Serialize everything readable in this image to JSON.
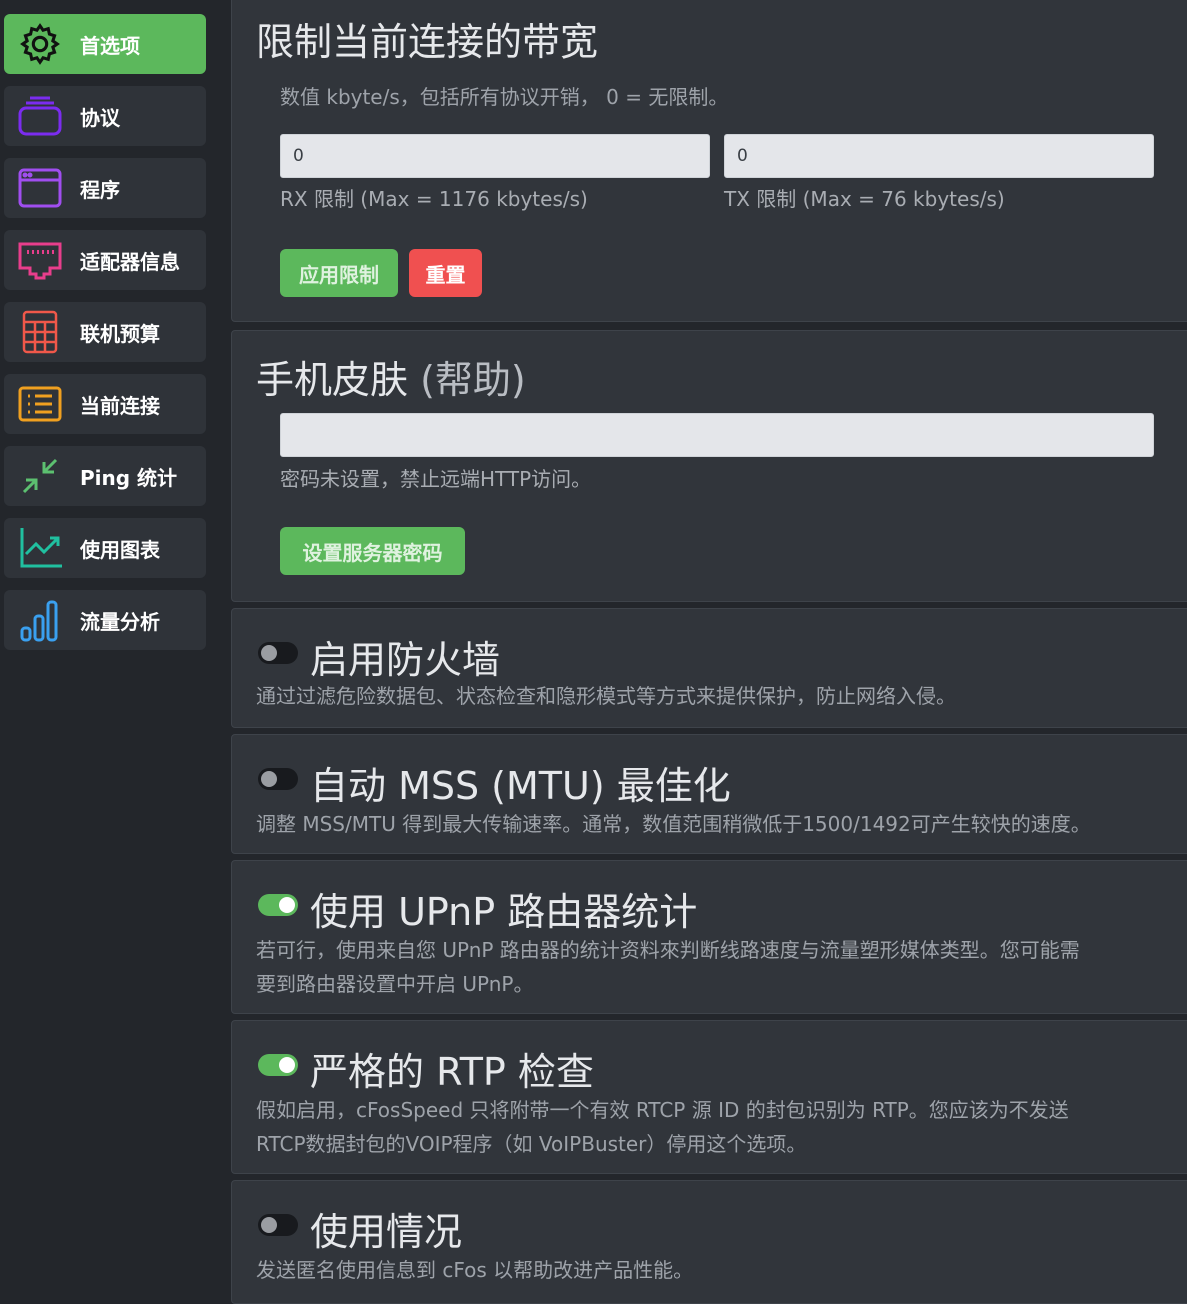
{
  "sidebar": {
    "items": [
      {
        "label": "首选项",
        "icon": "gear-icon",
        "active": true
      },
      {
        "label": "协议",
        "icon": "stack-icon"
      },
      {
        "label": "程序",
        "icon": "window-icon"
      },
      {
        "label": "适配器信息",
        "icon": "ethernet-port-icon"
      },
      {
        "label": "联机预算",
        "icon": "calculator-icon"
      },
      {
        "label": "当前连接",
        "icon": "list-icon"
      },
      {
        "label": "Ping 统计",
        "icon": "arrows-collapse-icon"
      },
      {
        "label": "使用图表",
        "icon": "line-chart-icon"
      },
      {
        "label": "流量分析",
        "icon": "bar-chart-icon"
      }
    ]
  },
  "bandwidth": {
    "title": "限制当前连接的带宽",
    "hint": "数值 kbyte/s，包括所有协议开销， 0 = 无限制。",
    "rx_value": "0",
    "tx_value": "0",
    "rx_label": "RX 限制 (Max = 1176 kbytes/s)",
    "tx_label": "TX 限制 (Max = 76 kbytes/s)",
    "apply_label": "应用限制",
    "reset_label": "重置"
  },
  "skin": {
    "title": "手机皮肤",
    "help": "(帮助)",
    "password_value": "",
    "status": "密码未设置，禁止远端HTTP访问。",
    "set_password_label": "设置服务器密码"
  },
  "toggles": [
    {
      "title": "启用防火墙",
      "on": false,
      "desc": [
        "通过过滤危险数据包、状态检查和隐形模式等方式来提供保护，防止网络入侵。"
      ]
    },
    {
      "title": "自动 MSS (MTU) 最佳化",
      "on": false,
      "desc": [
        "调整 MSS/MTU 得到最大传输速率。通常，数值范围稍微低于1500/1492可产生较快的速度。"
      ]
    },
    {
      "title": "使用 UPnP 路由器统计",
      "on": true,
      "desc": [
        "若可行，使用来自您 UPnP 路由器的统计资料來判断线路速度与流量塑形媒体类型。您可能需",
        "要到路由器设置中开启 UPnP。"
      ]
    },
    {
      "title": "严格的 RTP 检查",
      "on": true,
      "desc": [
        "假如启用，cFosSpeed 只将附带一个有效 RTCP 源 ID 的封包识别为 RTP。您应该为不发送",
        "RTCP数据封包的VOIP程序（如 VoIPBuster）停用这个选项。"
      ]
    },
    {
      "title": "使用情况",
      "on": false,
      "desc": [
        "发送匿名使用信息到 cFos 以帮助改进产品性能。"
      ]
    }
  ]
}
